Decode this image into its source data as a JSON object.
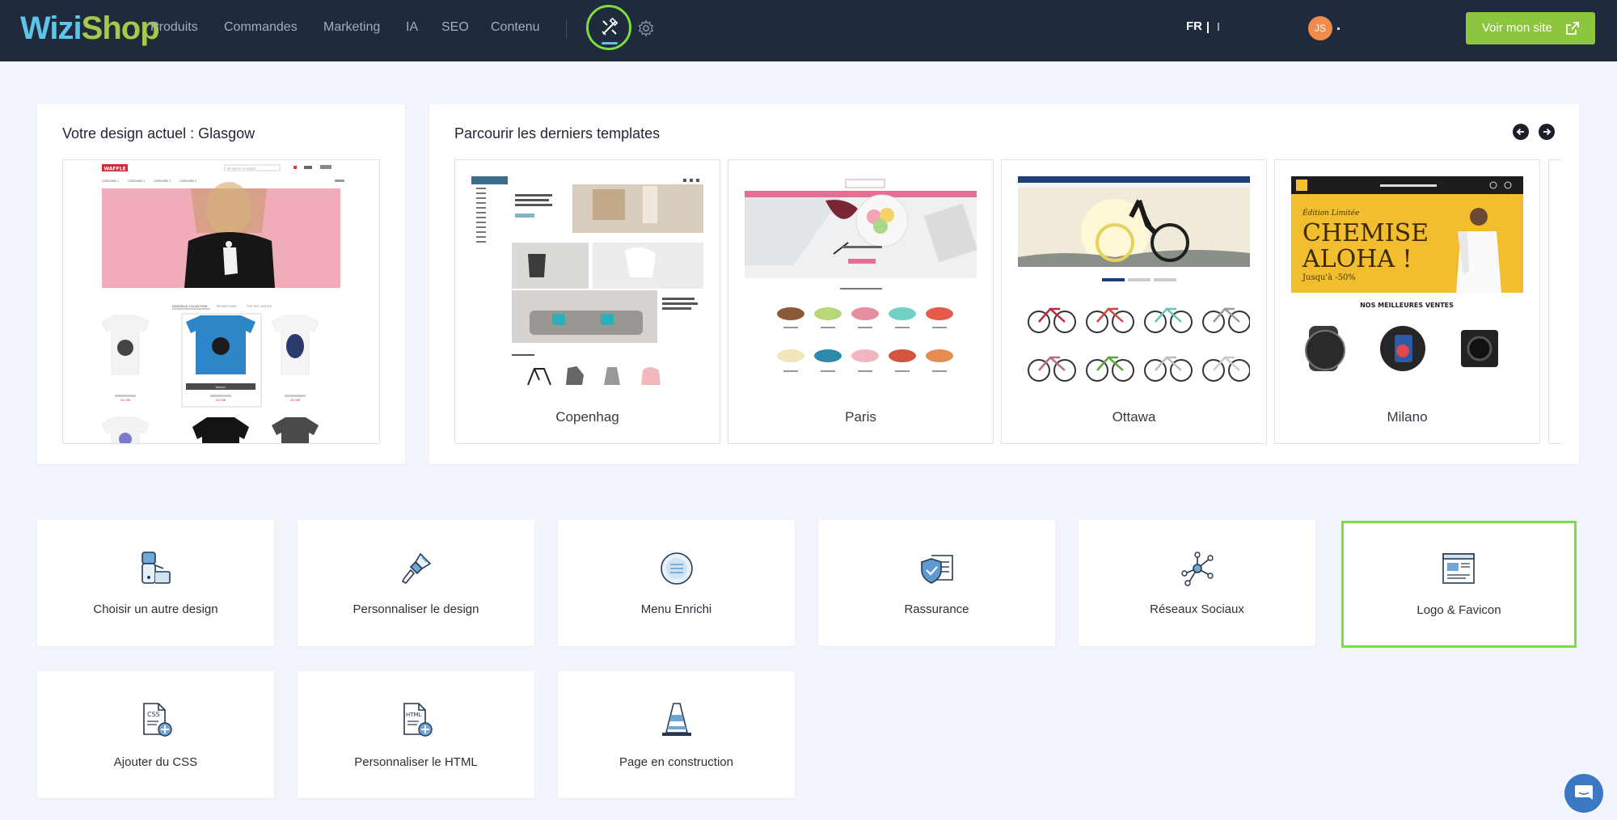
{
  "brand": {
    "logo_part1": "Wizi",
    "logo_part2": "Shop"
  },
  "nav": {
    "items": [
      "Produits",
      "Commandes",
      "Marketing",
      "IA",
      "SEO",
      "Contenu"
    ],
    "lang": "FR",
    "avatar_initials": "JS",
    "site_button": "Voir mon site"
  },
  "current_design": {
    "title": "Votre design actuel : Glasgow",
    "preview": {
      "brand": "WAFFLE",
      "search_placeholder": "Rechercher un produit",
      "menu": [
        "CATEGORIE 1",
        "CATEGORIE 2",
        "CATEGORIE 3",
        "CATEGORIE 4"
      ],
      "tabs": [
        "NOUVELLE COLLECTION",
        "PROMOTIONS",
        "TOP DES VENTES"
      ],
      "product_tag": "Ajouter",
      "price": "20,00€"
    }
  },
  "templates": {
    "title": "Parcourir les derniers templates",
    "items": [
      {
        "name": "Copenhag"
      },
      {
        "name": "Paris"
      },
      {
        "name": "Ottawa"
      },
      {
        "name": "Milano",
        "banner_small": "Édition Limitée",
        "banner_line1": "CHEMISE",
        "banner_line2": "ALOHA !",
        "banner_sub": "Jusqu'à -50%",
        "section_title": "NOS MEILLEURES VENTES"
      }
    ]
  },
  "tools": [
    {
      "label": "Choisir un autre design",
      "icon": "palette-icon"
    },
    {
      "label": "Personnaliser le design",
      "icon": "paintbrush-icon"
    },
    {
      "label": "Menu Enrichi",
      "icon": "menu-icon"
    },
    {
      "label": "Rassurance",
      "icon": "shield-check-icon"
    },
    {
      "label": "Réseaux Sociaux",
      "icon": "network-icon"
    },
    {
      "label": "Logo & Favicon",
      "icon": "browser-window-icon",
      "selected": true
    },
    {
      "label": "Ajouter du CSS",
      "icon": "css-file-icon"
    },
    {
      "label": "Personnaliser le HTML",
      "icon": "html-file-icon"
    },
    {
      "label": "Page en construction",
      "icon": "traffic-cone-icon"
    }
  ],
  "colors": {
    "topbar": "#1f2a3c",
    "accent_green": "#8cc63f",
    "highlight": "#7ddc40",
    "logo_blue": "#5ec4e8",
    "background": "#f2f5fb"
  }
}
